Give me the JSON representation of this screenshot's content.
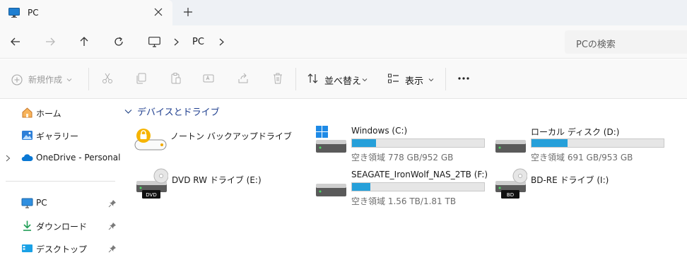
{
  "tab": {
    "title": "PC",
    "icon": "monitor-icon"
  },
  "address": {
    "path": "PC"
  },
  "search": {
    "placeholder": "PCの検索"
  },
  "toolbar": {
    "new_label": "新規作成",
    "sort_label": "並べ替え",
    "view_label": "表示"
  },
  "sidebar": {
    "items": [
      {
        "label": "ホーム",
        "icon": "home-icon"
      },
      {
        "label": "ギャラリー",
        "icon": "gallery-icon"
      },
      {
        "label": "OneDrive - Personal",
        "icon": "onedrive-icon"
      },
      {
        "label": "PC",
        "icon": "monitor-icon",
        "pinned": true
      },
      {
        "label": "ダウンロード",
        "icon": "download-icon",
        "pinned": true
      },
      {
        "label": "デスクトップ",
        "icon": "desktop-icon",
        "pinned": true
      }
    ]
  },
  "main": {
    "group_title": "デバイスとドライブ",
    "drives": [
      {
        "name": "ノートン バックアップドライブ",
        "icon": "norton-backup-icon"
      },
      {
        "name": "Windows (C:)",
        "space": "空き領域 778 GB/952 GB",
        "used_fraction": 0.183,
        "icon": "windows-drive-icon"
      },
      {
        "name": "ローカル ディスク (D:)",
        "space": "空き領域 691 GB/953 GB",
        "used_fraction": 0.275,
        "icon": "hdd-icon"
      },
      {
        "name": "DVD RW ドライブ (E:)",
        "badge": "DVD",
        "icon": "dvd-drive-icon"
      },
      {
        "name": "SEAGATE_IronWolf_NAS_2TB (F:)",
        "space": "空き領域 1.56 TB/1.81 TB",
        "used_fraction": 0.138,
        "icon": "hdd-icon"
      },
      {
        "name": "BD-RE ドライブ (I:)",
        "badge": "BD",
        "icon": "bd-drive-icon"
      }
    ]
  },
  "colors": {
    "accent": "#26a0da",
    "pin": "#7a7a7a"
  }
}
